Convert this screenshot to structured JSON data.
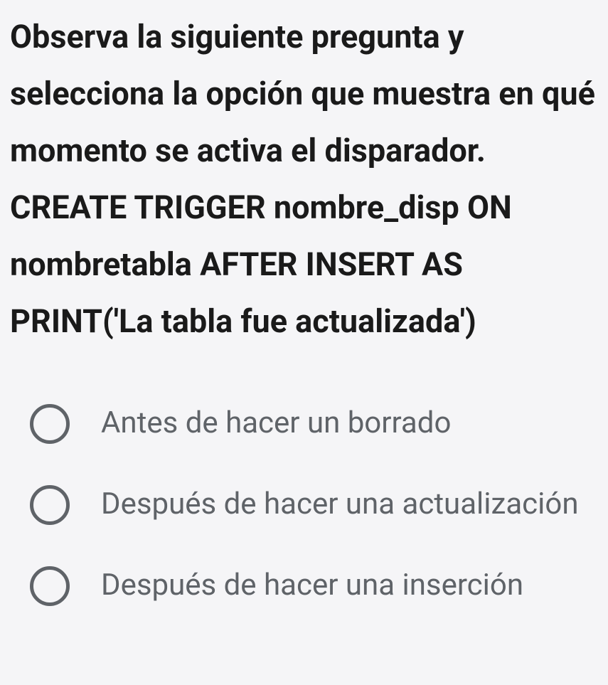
{
  "question": {
    "text": "Observa la siguiente pregunta y selecciona la opción que muestra en qué momento se activa el disparador.   CREATE TRIGGER nombre_disp ON nombretabla AFTER INSERT AS  PRINT('La tabla fue actualizada')"
  },
  "options": [
    {
      "label": "Antes de hacer un borrado"
    },
    {
      "label": "Después de hacer una actualización"
    },
    {
      "label": "Después de hacer una inserción"
    }
  ]
}
